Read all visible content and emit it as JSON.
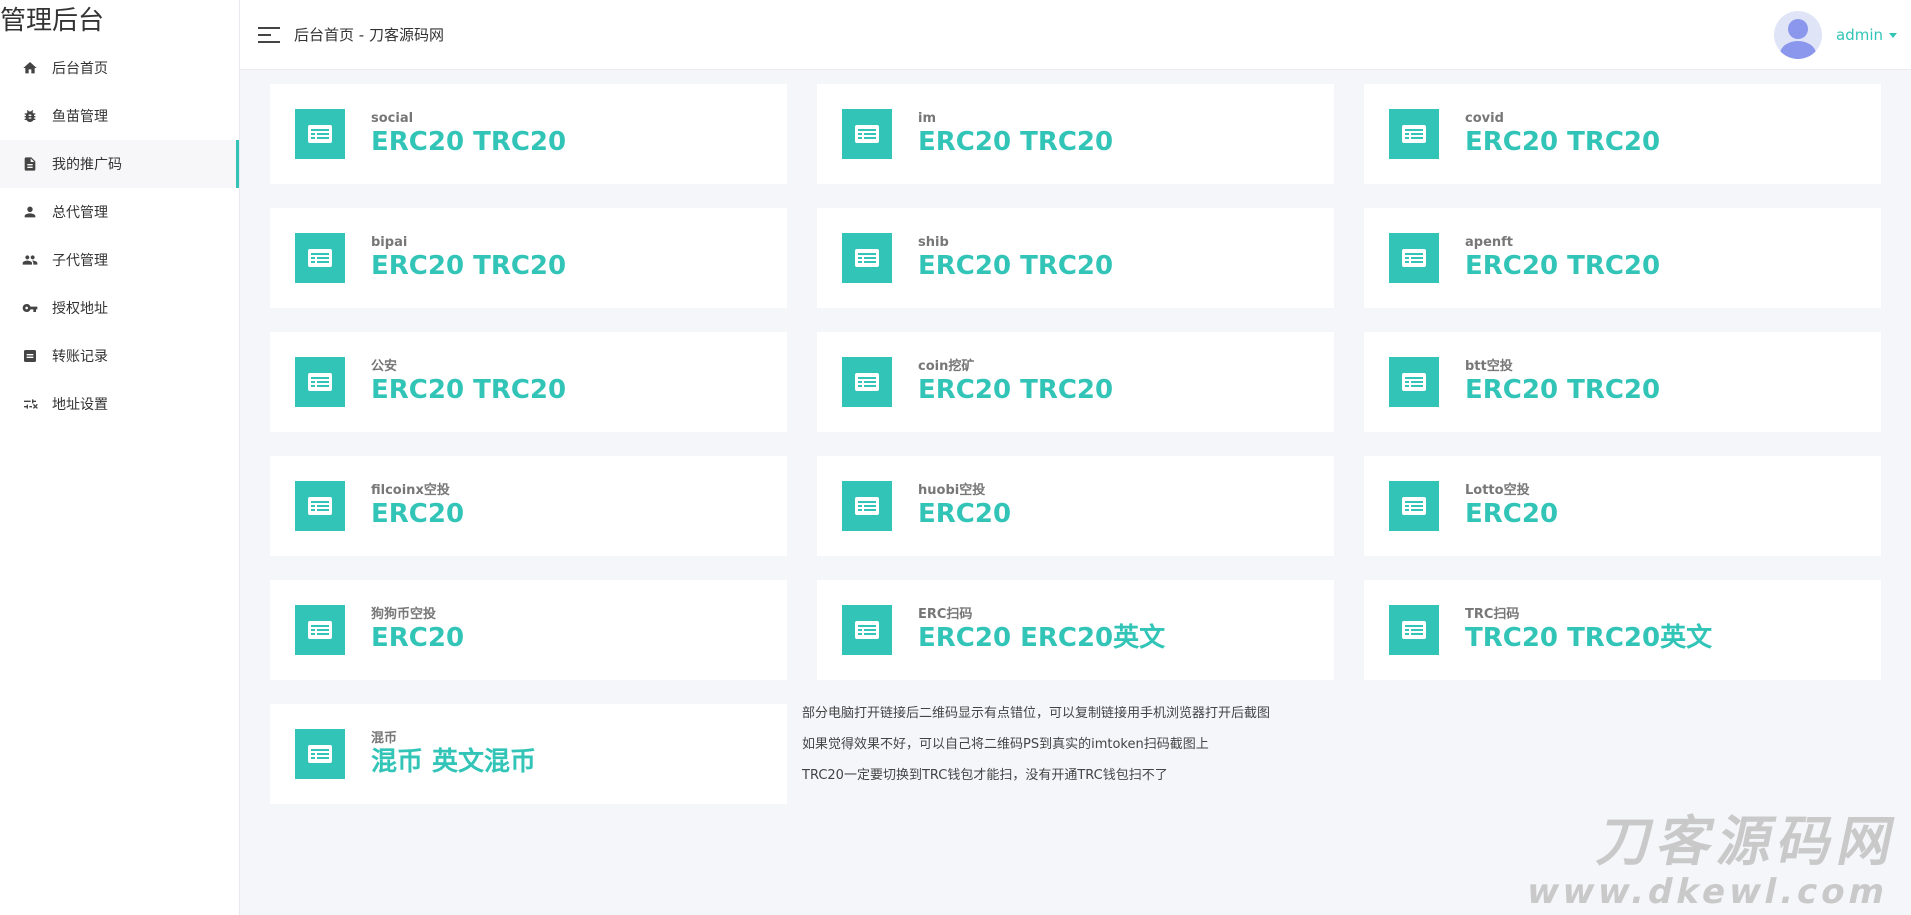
{
  "brand": "管理后台",
  "sidebar": {
    "items": [
      {
        "label": "后台首页",
        "icon": "home-icon"
      },
      {
        "label": "鱼苗管理",
        "icon": "bug-icon"
      },
      {
        "label": "我的推广码",
        "icon": "document-icon"
      },
      {
        "label": "总代管理",
        "icon": "person-icon"
      },
      {
        "label": "子代管理",
        "icon": "people-icon"
      },
      {
        "label": "授权地址",
        "icon": "key-icon"
      },
      {
        "label": "转账记录",
        "icon": "list-icon"
      },
      {
        "label": "地址设置",
        "icon": "tune-icon"
      }
    ],
    "active_index": 2
  },
  "header": {
    "breadcrumb": "后台首页 - 刀客源码网",
    "user": "admin"
  },
  "cards": [
    {
      "label": "social",
      "value": "ERC20 TRC20"
    },
    {
      "label": "im",
      "value": "ERC20 TRC20"
    },
    {
      "label": "covid",
      "value": "ERC20 TRC20"
    },
    {
      "label": "bipai",
      "value": "ERC20 TRC20"
    },
    {
      "label": "shib",
      "value": "ERC20 TRC20"
    },
    {
      "label": "apenft",
      "value": "ERC20 TRC20"
    },
    {
      "label": "公安",
      "value": "ERC20 TRC20"
    },
    {
      "label": "coin挖矿",
      "value": "ERC20 TRC20"
    },
    {
      "label": "btt空投",
      "value": "ERC20 TRC20"
    },
    {
      "label": "filcoinx空投",
      "value": "ERC20"
    },
    {
      "label": "huobi空投",
      "value": "ERC20"
    },
    {
      "label": "Lotto空投",
      "value": "ERC20"
    },
    {
      "label": "狗狗币空投",
      "value": "ERC20"
    },
    {
      "label": "ERC扫码",
      "value": "ERC20 ERC20英文"
    },
    {
      "label": "TRC扫码",
      "value": "TRC20 TRC20英文"
    },
    {
      "label": "混币",
      "value": "混币 英文混币"
    }
  ],
  "notes": [
    "部分电脑打开链接后二维码显示有点错位，可以复制链接用手机浏览器打开后截图",
    "如果觉得效果不好，可以自己将二维码PS到真实的imtoken扫码截图上",
    "TRC20一定要切换到TRC钱包才能扫，没有开通TRC钱包扫不了"
  ],
  "watermark": {
    "cn": "刀客源码网",
    "en": "www.dkewl.com"
  },
  "colors": {
    "accent": "#32c5b7",
    "background": "#f5f6fa"
  }
}
